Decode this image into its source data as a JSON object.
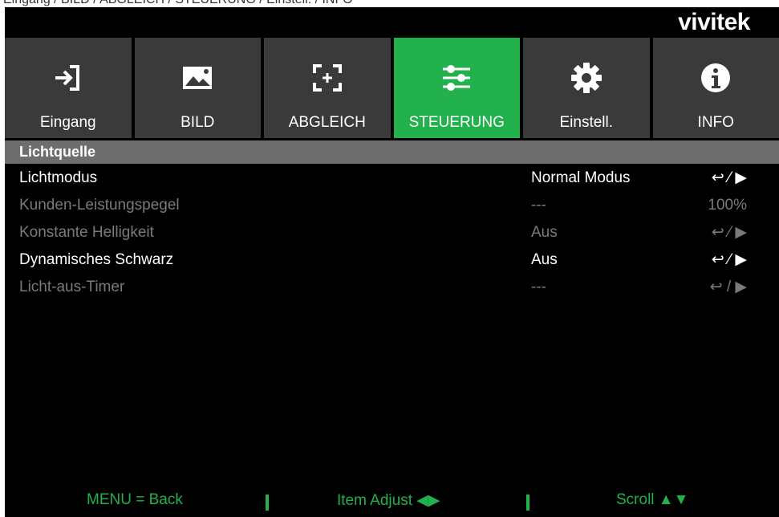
{
  "top_caption": "Eingang / BILD / ABGLEICH / STEUERUNG / Einstell. / INFO",
  "brand": "vivitek",
  "tabs": [
    {
      "label": "Eingang",
      "icon": "input-icon",
      "active": false
    },
    {
      "label": "BILD",
      "icon": "image-icon",
      "active": false
    },
    {
      "label": "ABGLEICH",
      "icon": "adjust-frame-icon",
      "active": false
    },
    {
      "label": "STEUERUNG",
      "icon": "sliders-icon",
      "active": true
    },
    {
      "label": "Einstell.",
      "icon": "gear-icon",
      "active": false
    },
    {
      "label": "INFO",
      "icon": "info-icon",
      "active": false
    }
  ],
  "section": {
    "title": "Lichtquelle"
  },
  "rows": [
    {
      "label": "Lichtmodus",
      "value": "Normal Modus",
      "action": "↩ ⁄ ▶",
      "enabled": true
    },
    {
      "label": "Kunden-Leistungspegel",
      "value": "---",
      "action": "100%",
      "enabled": false
    },
    {
      "label": "Konstante Helligkeit",
      "value": "Aus",
      "action": "↩ ⁄ ▶",
      "enabled": false
    },
    {
      "label": "Dynamisches Schwarz",
      "value": "Aus",
      "action": "↩ ⁄ ▶",
      "enabled": true
    },
    {
      "label": "Licht-aus-Timer",
      "value": "---",
      "action": "↩ / ▶",
      "enabled": false
    }
  ],
  "footer": {
    "back": "MENU = Back",
    "adjust": "Item Adjust ◀▶",
    "scroll": "Scroll ▲▼"
  },
  "colors": {
    "accent": "#22b14c",
    "tab_bg": "#3a3a3a",
    "header_bg": "#6e6e6e",
    "disabled_text": "#7a7a7a"
  }
}
